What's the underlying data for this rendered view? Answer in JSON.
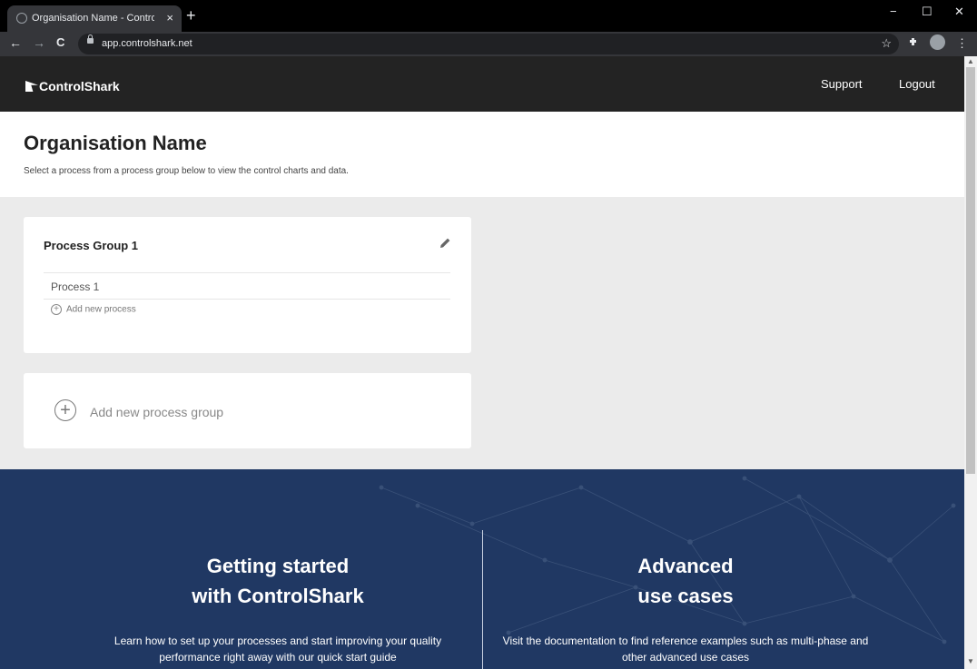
{
  "browser": {
    "tab_title": "Organisation Name - ControlShark",
    "tab_close": "×",
    "new_tab": "+",
    "url": "app.controlshark.net",
    "back": "←",
    "forward": "→",
    "reload": "C",
    "star": "☆",
    "menu": "⋮",
    "minimize": "−",
    "maximize": "☐",
    "close": "✕"
  },
  "header": {
    "logo": "ControlShark",
    "support": "Support",
    "logout": "Logout"
  },
  "intro": {
    "title": "Organisation Name",
    "subtitle": "Select a process from a process group below to view the control charts and data."
  },
  "groups": [
    {
      "title": "Process Group 1",
      "processes": [
        "Process 1"
      ],
      "add_process": "Add new process"
    }
  ],
  "add_group": "Add new process group",
  "footer": {
    "left": {
      "title_line1": "Getting started",
      "title_line2": "with ControlShark",
      "text": "Learn how to set up your processes and start improving your quality performance right away with our quick start guide"
    },
    "right": {
      "title_line1": "Advanced",
      "title_line2": "use cases",
      "text": "Visit the documentation to find reference examples such as multi-phase and other advanced use cases"
    }
  },
  "colors": {
    "header_bg": "#232323",
    "footer_bg": "#203863",
    "page_bg": "#ebebeb"
  },
  "icons": [
    "back-icon",
    "forward-icon",
    "reload-icon",
    "lock-icon",
    "star-icon",
    "extensions-icon",
    "profile-icon",
    "menu-icon",
    "pencil-icon",
    "plus-circle-icon"
  ]
}
